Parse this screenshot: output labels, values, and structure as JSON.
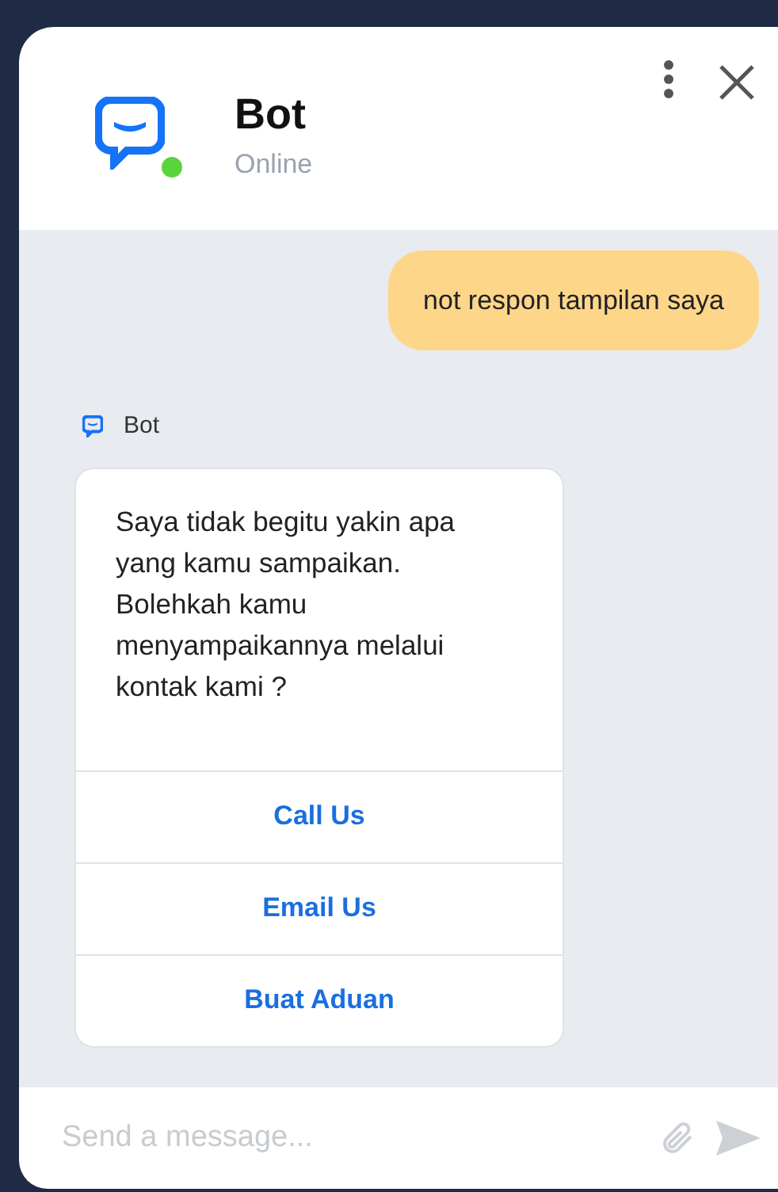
{
  "header": {
    "title": "Bot",
    "status": "Online",
    "online": true
  },
  "messages": [
    {
      "kind": "user",
      "text": "not respon tampilan saya"
    },
    {
      "kind": "bot",
      "sender": "Bot",
      "text": "Saya tidak begitu yakin apa yang kamu sampaikan. Bolehkah kamu menyampaikannya melalui kontak kami ?",
      "buttons": [
        "Call Us",
        "Email Us",
        "Buat Aduan"
      ]
    }
  ],
  "composer": {
    "placeholder": "Send a message..."
  }
}
